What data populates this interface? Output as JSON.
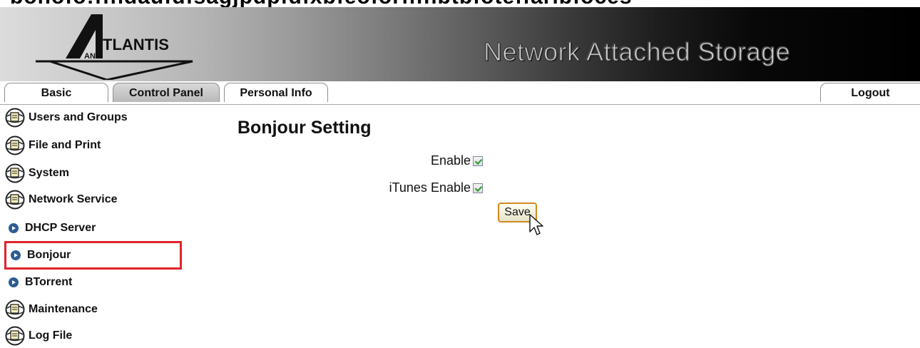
{
  "top_text": "bonofo:ffhdaufdfsagjpdpfdfxbfeoforfifhbtbfoteffaribfoces",
  "banner": {
    "logo_text": "TLANTIS",
    "logo_sub": "AND",
    "title": "Network Attached Storage"
  },
  "tabs": {
    "basic": "Basic",
    "control_panel": "Control Panel",
    "personal_info": "Personal Info",
    "logout": "Logout"
  },
  "sidebar": {
    "items": [
      {
        "label": "Users and Groups",
        "icon": "globe-folder-icon"
      },
      {
        "label": "File and Print",
        "icon": "globe-folder-icon"
      },
      {
        "label": "System",
        "icon": "globe-folder-icon"
      },
      {
        "label": "Network Service",
        "icon": "globe-folder-icon"
      },
      {
        "label": "DHCP Server",
        "icon": "blue-arrow-icon"
      },
      {
        "label": "Bonjour",
        "icon": "blue-arrow-icon",
        "selected": true
      },
      {
        "label": "BTorrent",
        "icon": "blue-arrow-icon"
      },
      {
        "label": "Maintenance",
        "icon": "globe-folder-icon"
      },
      {
        "label": "Log File",
        "icon": "globe-folder-icon"
      }
    ]
  },
  "main": {
    "title": "Bonjour Setting",
    "fields": [
      {
        "label": "Enable",
        "checked": true
      },
      {
        "label": "iTunes Enable",
        "checked": true
      }
    ],
    "save_label": "Save"
  },
  "colors": {
    "selection_outline": "#e3222a",
    "save_border": "#d08a20",
    "arrow_icon": "#2e5c93",
    "checkmark": "#2e9a2e"
  }
}
